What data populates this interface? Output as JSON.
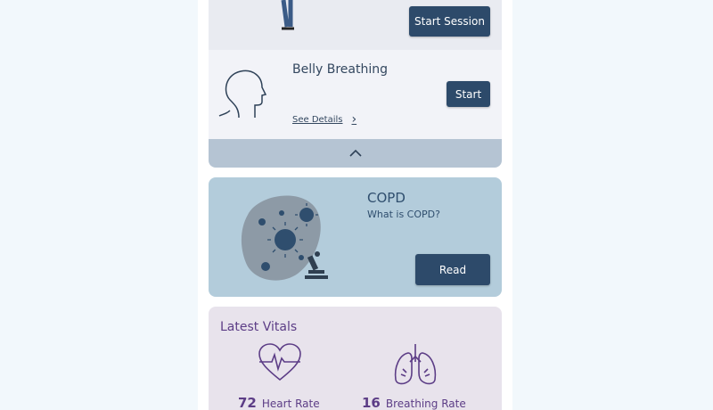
{
  "session": {
    "start_label": "Start Session"
  },
  "belly": {
    "title": "Belly Breathing",
    "see_details": "See Details",
    "start_label": "Start"
  },
  "collapse": {
    "icon": "chevron-up-icon"
  },
  "copd": {
    "title": "COPD",
    "subtitle": "What is COPD?",
    "read_label": "Read"
  },
  "vitals": {
    "title": "Latest Vitals",
    "heart_rate_value": "72",
    "heart_rate_label": "Heart Rate",
    "breathing_rate_value": "16",
    "breathing_rate_label": "Breathing Rate"
  },
  "colors": {
    "primary_button": "#2d4a6a",
    "copd_card": "#b3ccdb",
    "vitals_accent": "#5c3d86"
  }
}
